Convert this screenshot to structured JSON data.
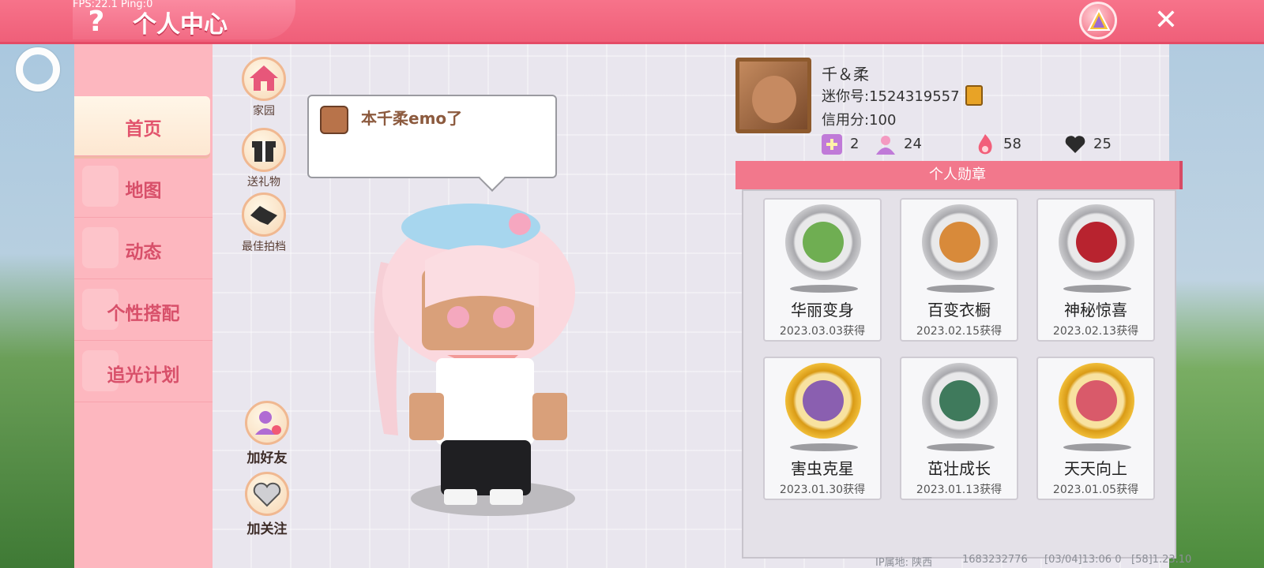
{
  "debug": {
    "fps": "FPS:22.1  Ping:0"
  },
  "header": {
    "title": "个人中心",
    "help_icon": "question-icon",
    "report_icon": "warning-icon",
    "close_icon": "close-icon"
  },
  "sidebar": {
    "items": [
      {
        "label": "首页",
        "active": true
      },
      {
        "label": "地图"
      },
      {
        "label": "动态"
      },
      {
        "label": "个性搭配"
      },
      {
        "label": "追光计划"
      }
    ]
  },
  "side_buttons": {
    "home": "家园",
    "gift": "送礼物",
    "partner": "最佳拍档",
    "add_friend": "加好友",
    "follow": "加关注"
  },
  "bubble": {
    "message": "本千柔emo了"
  },
  "profile": {
    "name": "千＆柔",
    "mini_id": "迷你号:1524319557",
    "credit": "信用分:100",
    "stats": [
      {
        "icon": "plus-badge-icon",
        "value": "2"
      },
      {
        "icon": "fans-icon",
        "value": "24"
      },
      {
        "icon": "flame-icon",
        "value": "58"
      },
      {
        "icon": "heart-icon",
        "value": "25"
      }
    ]
  },
  "medals": {
    "header": "个人勋章",
    "items": [
      {
        "name": "华丽变身",
        "date": "2023.03.03获得",
        "tier": "silver",
        "inner_color": "#6fae52"
      },
      {
        "name": "百变衣橱",
        "date": "2023.02.15获得",
        "tier": "silver",
        "inner_color": "#d88a3a"
      },
      {
        "name": "神秘惊喜",
        "date": "2023.02.13获得",
        "tier": "silver",
        "inner_color": "#b8232f"
      },
      {
        "name": "害虫克星",
        "date": "2023.01.30获得",
        "tier": "gold",
        "inner_color": "#8a5fb0"
      },
      {
        "name": "茁壮成长",
        "date": "2023.01.13获得",
        "tier": "silver",
        "inner_color": "#3f7a5c"
      },
      {
        "name": "天天向上",
        "date": "2023.01.05获得",
        "tier": "gold",
        "inner_color": "#d95a6a"
      }
    ]
  },
  "footer": {
    "ip": "IP属地: 陕西",
    "uid": "1683232776",
    "time": "[03/04]13:06 0",
    "version": "[58]1.23.10"
  }
}
